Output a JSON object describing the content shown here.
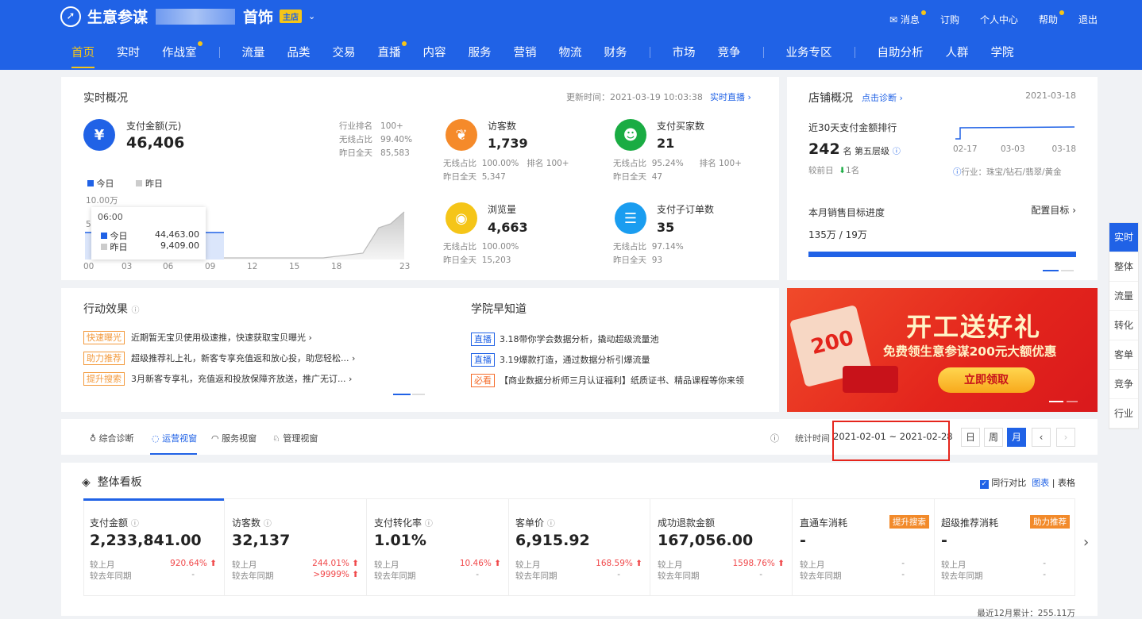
{
  "brand": {
    "name_left": "生意参谋",
    "name_right": "首饰",
    "badge": "主店"
  },
  "top_links": [
    "消息",
    "订购",
    "个人中心",
    "帮助",
    "退出"
  ],
  "nav": [
    "首页",
    "实时",
    "作战室",
    "流量",
    "品类",
    "交易",
    "直播",
    "内容",
    "服务",
    "营销",
    "物流",
    "财务",
    "市场",
    "竞争",
    "业务专区",
    "自助分析",
    "人群",
    "学院"
  ],
  "realtime": {
    "title": "实时概况",
    "update": "更新时间：2021-03-19 10:03:38",
    "live": "实时直播 ›",
    "pay_label": "支付金额(元)",
    "pay_value": "46,406",
    "rank_label": "行业排名",
    "rank_value": "100+",
    "wireless_label": "无线占比",
    "wireless_value": "99.40%",
    "yday_label": "昨日全天",
    "yday_value": "85,583",
    "legend_today": "今日",
    "legend_yday": "昨日",
    "ymax": "10.00万",
    "tooltip_time": "06:00",
    "tooltip_today": "44,463.00",
    "tooltip_yday": "9,409.00",
    "xticks": [
      "00",
      "03",
      "06",
      "09",
      "12",
      "15",
      "18",
      "23"
    ],
    "y5": "5",
    "y0": "0",
    "metrics": [
      {
        "label": "访客数",
        "value": "1,739",
        "l1": "无线占比",
        "v1": "100.00%",
        "rank": "排名 100+",
        "l2": "昨日全天",
        "v2": "5,347"
      },
      {
        "label": "支付买家数",
        "value": "21",
        "l1": "无线占比",
        "v1": "95.24%",
        "rank": "排名 100+",
        "l2": "昨日全天",
        "v2": "47"
      },
      {
        "label": "浏览量",
        "value": "4,663",
        "l1": "无线占比",
        "v1": "100.00%",
        "rank": "",
        "l2": "昨日全天",
        "v2": "15,203"
      },
      {
        "label": "支付子订单数",
        "value": "35",
        "l1": "无线占比",
        "v1": "97.14%",
        "rank": "",
        "l2": "昨日全天",
        "v2": "93"
      }
    ]
  },
  "store": {
    "title": "店铺概况",
    "diag": "点击诊断 ›",
    "date": "2021-03-18",
    "rank_title": "近30天支付金额排行",
    "rank_value": "242",
    "rank_unit": "名 第五层级",
    "cmp_label": "较前日",
    "cmp_value": "1名",
    "dates": [
      "02-17",
      "03-03",
      "03-18"
    ],
    "industry": "行业：珠宝/钻石/翡翠/黄金",
    "goal_title": "本月销售目标进度",
    "goal_set": "配置目标 ›",
    "goal_value": "135万 / 19万"
  },
  "action": {
    "title": "行动效果",
    "items": [
      {
        "tag": "快速曝光",
        "text": "近期暂无宝贝使用极速推，快速获取宝贝曝光 ›"
      },
      {
        "tag": "助力推荐",
        "text": "超级推荐礼上礼，新客专享充值返和放心投，助您轻松... ›"
      },
      {
        "tag": "提升搜索",
        "text": "3月新客专享礼，充值返和投放保障齐放送，推广无订... ›"
      }
    ]
  },
  "academy": {
    "title": "学院早知道",
    "items": [
      {
        "tag": "直播",
        "text": "3.18带你学会数据分析，撬动超级流量池"
      },
      {
        "tag": "直播",
        "text": "3.19爆款打造，通过数据分析引爆流量"
      },
      {
        "tag": "必看",
        "text": "【商业数据分析师三月认证福利】纸质证书、精品课程等你来领"
      }
    ]
  },
  "banner": {
    "title": "开工送好礼",
    "sub": "免费领生意参谋200元大额优惠",
    "btn": "立即领取",
    "coupon": "200"
  },
  "tabs": [
    "综合诊断",
    "运营视窗",
    "服务视窗",
    "管理视窗"
  ],
  "stat": {
    "label": "统计时间",
    "range": "2021-02-01 ~ 2021-02-28",
    "btns": [
      "日",
      "周",
      "月"
    ]
  },
  "board": {
    "title": "整体看板",
    "compare": "同行对比",
    "chart": "图表",
    "table": "表格",
    "footer": "最近12月累计：255.11万"
  },
  "kpis": [
    {
      "label": "支付金额",
      "value": "2,233,841.00",
      "mom": "920.64%",
      "yoy": "-",
      "badge": ""
    },
    {
      "label": "访客数",
      "value": "32,137",
      "mom": "244.01%",
      "yoy": ">9999%",
      "badge": ""
    },
    {
      "label": "支付转化率",
      "value": "1.01%",
      "mom": "10.46%",
      "yoy": "-",
      "badge": ""
    },
    {
      "label": "客单价",
      "value": "6,915.92",
      "mom": "168.59%",
      "yoy": "-",
      "badge": ""
    },
    {
      "label": "成功退款金额",
      "value": "167,056.00",
      "mom": "1598.76%",
      "yoy": "-",
      "badge": ""
    },
    {
      "label": "直通车消耗",
      "value": "-",
      "mom": "-",
      "yoy": "-",
      "badge": "提升搜索"
    },
    {
      "label": "超级推荐消耗",
      "value": "-",
      "mom": "-",
      "yoy": "-",
      "badge": "助力推荐"
    }
  ],
  "kpi_row_labels": {
    "mom": "较上月",
    "yoy": "较去年同期"
  },
  "sidebar": [
    "实时",
    "整体",
    "流量",
    "转化",
    "客单",
    "竞争",
    "行业"
  ]
}
